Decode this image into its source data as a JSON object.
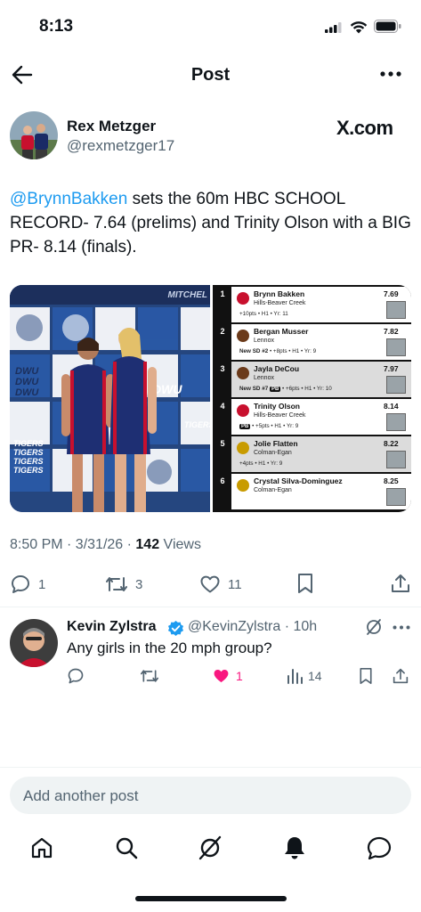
{
  "status_bar": {
    "time": "8:13",
    "icons": [
      "signal-icon",
      "wifi-icon",
      "battery-icon"
    ]
  },
  "header": {
    "title": "Post",
    "back_icon": "arrow-left-icon",
    "more_icon": "more-horizontal-icon"
  },
  "post": {
    "author_name": "Rex Metzger",
    "author_handle": "@rexmetzger17",
    "source_label": "X.com",
    "mention": "@BrynnBakken",
    "text_rest": " sets the 60m HBC SCHOOL RECORD- 7.64 (prelims) and Trinity Olson with a BIG PR- 8.14 (finals).",
    "timestamp": "8:50 PM · 3/31/26 · ",
    "views_count": "142",
    "views_label": " Views",
    "media": {
      "photo_banner_words": [
        "DWU",
        "DWU",
        "DWU",
        "TIGERS",
        "TIGERS",
        "TIGERS",
        "TIGERS",
        "MITCHEL",
        "DWU",
        "TIGERS"
      ],
      "results": [
        {
          "rank": "1",
          "name": "Brynn Bakken",
          "time": "7.69",
          "school": "Hills-Beaver Creek",
          "detail": "+10pts • H1 • Yr: 11",
          "badge": "",
          "pb": "",
          "logo_color": "#c8102e"
        },
        {
          "rank": "2",
          "name": "Bergan Musser",
          "time": "7.82",
          "school": "Lennox",
          "detail": " • +8pts • H1 • Yr: 9",
          "badge": "New SD #2",
          "pb": "",
          "logo_color": "#6b3a1a"
        },
        {
          "rank": "3",
          "name": "Jayla DeCou",
          "time": "7.97",
          "school": "Lennox",
          "detail": " • +6pts • H1 • Yr: 10",
          "badge": "New SD #7",
          "pb": "PB",
          "logo_color": "#6b3a1a"
        },
        {
          "rank": "4",
          "name": "Trinity Olson",
          "time": "8.14",
          "school": "Hills-Beaver Creek",
          "detail": " • +5pts • H1 • Yr: 9",
          "badge": "",
          "pb": "PB",
          "logo_color": "#c8102e"
        },
        {
          "rank": "5",
          "name": "Jolie Flatten",
          "time": "8.22",
          "school": "Colman-Egan",
          "detail": "+4pts • H1 • Yr: 9",
          "badge": "",
          "pb": "",
          "logo_color": "#c89b00"
        },
        {
          "rank": "6",
          "name": "Crystal Silva-Dominguez",
          "time": "8.25",
          "school": "Colman-Egan",
          "detail": "",
          "badge": "",
          "pb": "",
          "logo_color": "#c89b00"
        }
      ]
    },
    "actions": {
      "replies": "1",
      "reposts": "3",
      "likes": "11"
    }
  },
  "reply": {
    "name": "Kevin Zylstra",
    "handle": "@KevinZylstra · 10h",
    "text": "Any girls in the 20 mph group?",
    "likes": "1",
    "views": "14"
  },
  "composer": {
    "placeholder": "Add another post"
  },
  "tabbar": {
    "items": [
      "home-icon",
      "search-icon",
      "grok-icon",
      "notifications-icon",
      "messages-icon"
    ]
  },
  "colors": {
    "accent": "#1d9bf0",
    "like": "#f91880",
    "text": "#0f1419",
    "secondary": "#536471"
  }
}
